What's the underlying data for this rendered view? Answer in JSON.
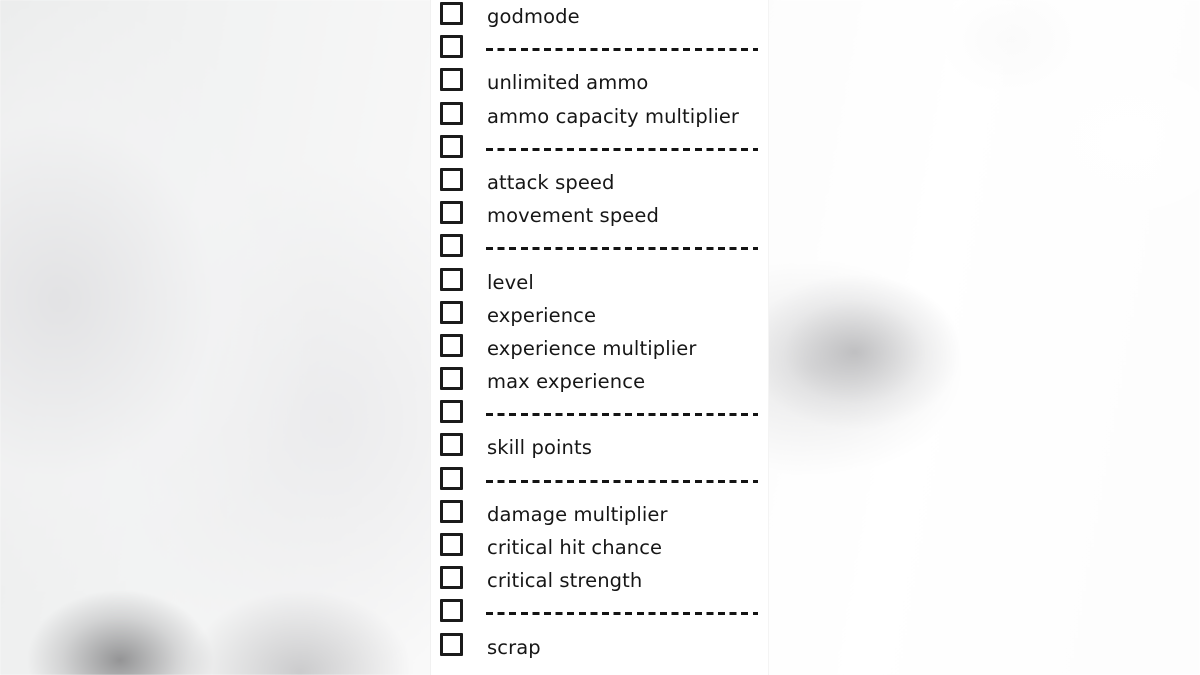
{
  "window": {
    "panel_title": "cheat options list",
    "background_description": "blurred light gray desktop"
  },
  "colors": {
    "panel_background": "#ffffff",
    "text": "#161616",
    "checkbox_border": "#1b1b1b",
    "separator": "#141414",
    "backdrop": "#f4f4f4"
  },
  "list": {
    "checkbox_state": "unchecked",
    "rows": [
      {
        "type": "option",
        "label": "godmode"
      },
      {
        "type": "separator",
        "label": ""
      },
      {
        "type": "option",
        "label": "unlimited ammo"
      },
      {
        "type": "option",
        "label": "ammo capacity multiplier"
      },
      {
        "type": "separator",
        "label": ""
      },
      {
        "type": "option",
        "label": "attack speed"
      },
      {
        "type": "option",
        "label": "movement speed"
      },
      {
        "type": "separator",
        "label": ""
      },
      {
        "type": "option",
        "label": "level"
      },
      {
        "type": "option",
        "label": "experience"
      },
      {
        "type": "option",
        "label": "experience multiplier"
      },
      {
        "type": "option",
        "label": "max experience"
      },
      {
        "type": "separator",
        "label": ""
      },
      {
        "type": "option",
        "label": "skill points"
      },
      {
        "type": "separator",
        "label": ""
      },
      {
        "type": "option",
        "label": "damage multiplier"
      },
      {
        "type": "option",
        "label": "critical hit chance"
      },
      {
        "type": "option",
        "label": "critical strength"
      },
      {
        "type": "separator",
        "label": ""
      },
      {
        "type": "option",
        "label": "scrap"
      }
    ]
  }
}
